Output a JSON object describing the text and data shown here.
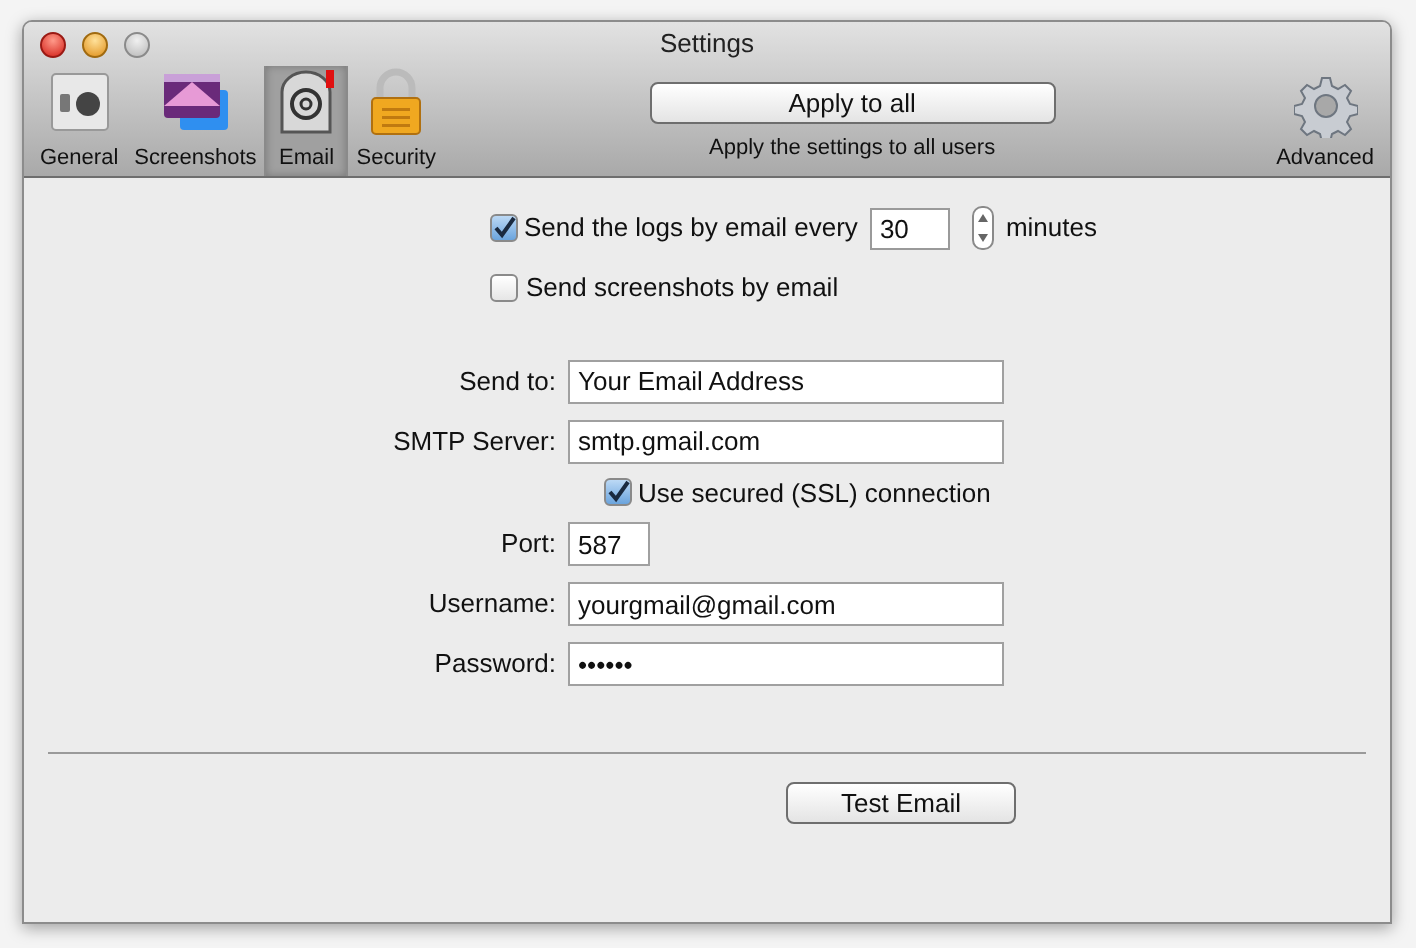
{
  "window": {
    "title": "Settings"
  },
  "tabs": [
    {
      "kind": "general",
      "label": "General",
      "selected": false
    },
    {
      "kind": "screenshots",
      "label": "Screenshots",
      "selected": false
    },
    {
      "kind": "email",
      "label": "Email",
      "selected": true
    },
    {
      "kind": "security",
      "label": "Security",
      "selected": false
    }
  ],
  "apply": {
    "button": "Apply to all",
    "caption": "Apply the settings to all users"
  },
  "advanced": {
    "label": "Advanced"
  },
  "send_logs": {
    "label": "Send the logs by email every",
    "checked": true,
    "value": "30",
    "unit": "minutes"
  },
  "send_screenshots": {
    "label": "Send screenshots by email",
    "checked": false
  },
  "fields": [
    {
      "kind": "text",
      "label": "Send to:",
      "value": "Your Email Address"
    },
    {
      "kind": "text",
      "label": "SMTP Server:",
      "value": "smtp.gmail.com"
    },
    {
      "kind": "checkbox",
      "label": "Use secured (SSL) connection",
      "checked": true
    },
    {
      "kind": "number",
      "label": "Port:",
      "value": "587"
    },
    {
      "kind": "text",
      "label": "Username:",
      "value": "yourgmail@gmail.com"
    },
    {
      "kind": "password",
      "label": "Password:",
      "value": "••••••"
    }
  ],
  "test_button": "Test Email"
}
